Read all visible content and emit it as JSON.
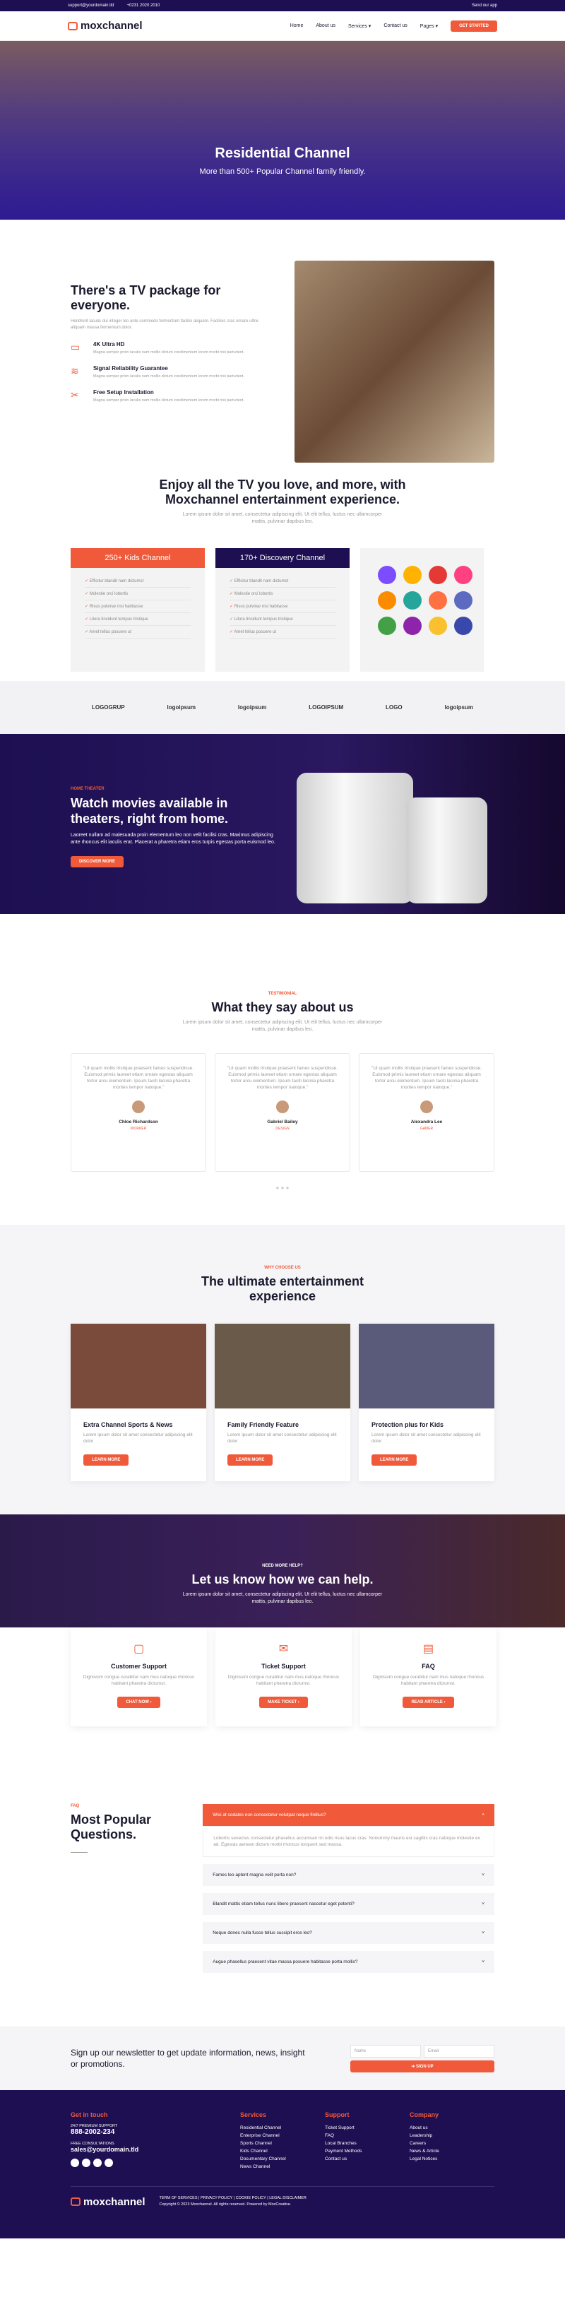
{
  "topbar": {
    "email": "support@yourdomain.tld",
    "phone": "+0231 2020 2010",
    "cart": "Send our app"
  },
  "nav": {
    "logo": "moxchannel",
    "links": [
      "Home",
      "About us",
      "Services ▾",
      "Contact us",
      "Pages ▾"
    ],
    "cta": "GET STARTED"
  },
  "hero": {
    "title": "Residential Channel",
    "subtitle": "More than 500+ Popular Channel family friendly."
  },
  "package": {
    "title": "There's a TV package for everyone.",
    "desc": "Hendrerit iaculis dui integer leo ante commodo fermentum facilisi aliquam. Facilisis cras ornare ultrix aliquam massa fermentum dolor.",
    "features": [
      {
        "icon": "video-icon",
        "title": "4K Ultra HD",
        "desc": "Magna semper proin iaculis nam mollis dictum condimentum lorem morbi nisi parturient."
      },
      {
        "icon": "signal-icon",
        "title": "Signal Reliability Guarantee",
        "desc": "Magna semper proin iaculis nam mollis dictum condimentum lorem morbi nisi parturient."
      },
      {
        "icon": "tools-icon",
        "title": "Free Setup Installation",
        "desc": "Magna semper proin iaculis nam mollis dictum condimentum lorem morbi nisi parturient."
      }
    ]
  },
  "enjoy": {
    "title": "Enjoy all the TV you love, and more, with Moxchannel entertainment experience.",
    "desc": "Lorem ipsum dolor sit amet, consectetur adipiscing elit. Ut elit tellus, luctus nec ullamcorper mattis, pulvinar dapibus leo."
  },
  "plans": [
    {
      "title": "250+ Kids Channel",
      "color": "#f05a3a",
      "items": [
        "Efficitur blandit nam dictumst",
        "Molestie orci lobortis",
        "Risus pulvinar nisi habitasse",
        "Litora tincidunt tempus tristique",
        "Amet tellus posuere ut"
      ]
    },
    {
      "title": "170+ Discovery Channel",
      "color": "#1d0f52",
      "items": [
        "Efficitur blandit nam dictumst",
        "Molestie orci lobortis",
        "Risus pulvinar nisi habitasse",
        "Litora tincidunt tempus tristique",
        "Amet tellus posuere ut"
      ]
    }
  ],
  "apps": [
    "#7c4dff",
    "#ffb300",
    "#e53935",
    "#ff4081",
    "#fb8c00",
    "#26a69a",
    "#ff7043",
    "#5c6bc0",
    "#43a047",
    "#8e24aa",
    "#fbc02d",
    "#3949ab"
  ],
  "logos": [
    "LOGOGRUP",
    "logoipsum",
    "logoipsum",
    "LOGOIPSUM",
    "LOGO",
    "logoipsum"
  ],
  "watch": {
    "tag": "HOME THEATER",
    "title": "Watch movies available in theaters, right from home.",
    "desc": "Laoreet nullam ad malesuada proin elementum leo non velit facilisi cras. Maximus adipiscing ante rhoncus elit iaculis erat. Placerat a pharetra etiam eros turpis egestas porta euismod leo.",
    "cta": "DISCOVER MORE"
  },
  "testimonials": {
    "tag": "TESTIMONIAL",
    "title": "What they say about us",
    "desc": "Lorem ipsum dolor sit amet, consectetur adipiscing elit. Ut elit tellus, luctus nec ullamcorper mattis, pulvinar dapibus leo.",
    "items": [
      {
        "quote": "\"Ut quam mollis tristique praesent fames suspendisse. Euismod primis laoreet etiam ornare egestas aliquam tortor arcu elementum. Ipsum taciti lacinia pharetra montes tempor natoque.\"",
        "name": "Chloe Richardson",
        "role": "WORKER"
      },
      {
        "quote": "\"Ut quam mollis tristique praesent fames suspendisse. Euismod primis laoreet etiam ornare egestas aliquam tortor arcu elementum. Ipsum taciti lacinia pharetra montes tempor natoque.\"",
        "name": "Gabriel Bailey",
        "role": "DESIGN"
      },
      {
        "quote": "\"Ut quam mollis tristique praesent fames suspendisse. Euismod primis laoreet etiam ornare egestas aliquam tortor arcu elementum. Ipsum taciti lacinia pharetra montes tempor natoque.\"",
        "name": "Alexandra Lee",
        "role": "GAMER"
      }
    ]
  },
  "ultimate": {
    "tag": "WHY CHOOSE US",
    "title": "The ultimate entertainment experience",
    "items": [
      {
        "title": "Extra Channel Sports & News",
        "desc": "Lorem ipsum dolor sit amet consectetur adipiscing elit dolor",
        "cta": "LEARN MORE",
        "img": "#7a4a3a"
      },
      {
        "title": "Family Friendly Feature",
        "desc": "Lorem ipsum dolor sit amet consectetur adipiscing elit dolor",
        "cta": "LEARN MORE",
        "img": "#6a5a4a"
      },
      {
        "title": "Protection plus for Kids",
        "desc": "Lorem ipsum dolor sit amet consectetur adipiscing elit dolor",
        "cta": "LEARN MORE",
        "img": "#5a5a7a"
      }
    ]
  },
  "help": {
    "tag": "NEED MORE HELP?",
    "title": "Let us know how we can help.",
    "desc": "Lorem ipsum dolor sit amet, consectetur adipiscing elit. Ut elit tellus, luctus nec ullamcorper mattis, pulvinar dapibus leo.",
    "items": [
      {
        "icon": "chat-icon",
        "title": "Customer Support",
        "desc": "Dignissim congue curabitur nam mus natoque rhoncus habitant pharetra dictumst.",
        "cta": "CHAT NOW ›"
      },
      {
        "icon": "ticket-icon",
        "title": "Ticket Support",
        "desc": "Dignissim congue curabitur nam mus natoque rhoncus habitant pharetra dictumst.",
        "cta": "MAKE TICKET ›"
      },
      {
        "icon": "document-icon",
        "title": "FAQ",
        "desc": "Dignissim congue curabitur nam mus natoque rhoncus habitant pharetra dictumst.",
        "cta": "READ ARTICLE ›"
      }
    ]
  },
  "faq": {
    "tag": "FAQ",
    "title": "Most Popular Questions.",
    "items": [
      "Wisi at sodales non consectetur volutpat neque finibus?",
      "Fames leo aptent magna velit porta non?",
      "Blandit mattis etiam tellus nunc libero praesent nascetur eget potenti?",
      "Neque donec nulla fusce tellus suscipit eros leo?",
      "Augue phasellus praesent vitae massa posuere habitasse porta mollis?"
    ],
    "answer": "Lobortis senectus consectetur phasellus accumsan mi odio risus lacus cras. Nonummy mauris est sagittis cras natoque molestie ex ad. Egestas aenean dictum morbi rhoncus torquent sed massa."
  },
  "newsletter": {
    "title": "Sign up our newsletter to get update information, news, insight or promotions.",
    "name": "Name",
    "email": "Email",
    "cta": "➔ SIGN UP"
  },
  "footer": {
    "touch": "Get in touch",
    "premium_label": "24/7 PREMIUM SUPPORT",
    "premium": "888-2002-234",
    "consult_label": "FREE CONSULTATIONS",
    "consult": "sales@yourdomain.tld",
    "cols": [
      {
        "title": "Services",
        "items": [
          "Residential Channel",
          "Enterprise Channel",
          "Sports Channel",
          "Kids Channel",
          "Documentary Channel",
          "News Channel"
        ]
      },
      {
        "title": "Support",
        "items": [
          "Ticket Support",
          "FAQ",
          "Local Branches",
          "Payment Methods",
          "Contact us"
        ]
      },
      {
        "title": "Company",
        "items": [
          "About us",
          "Leadership",
          "Careers",
          "News & Article",
          "Legal Notices"
        ]
      }
    ],
    "bottom_links": "TERM OF SERVICES  |  PRIVACY POLICY  |  COOKIE POLICY  |  LEGAL DISCLAIMER",
    "copyright": "Copyright © 2023 Moxchannel. All rights reserved. Powered by MoxCreative."
  }
}
